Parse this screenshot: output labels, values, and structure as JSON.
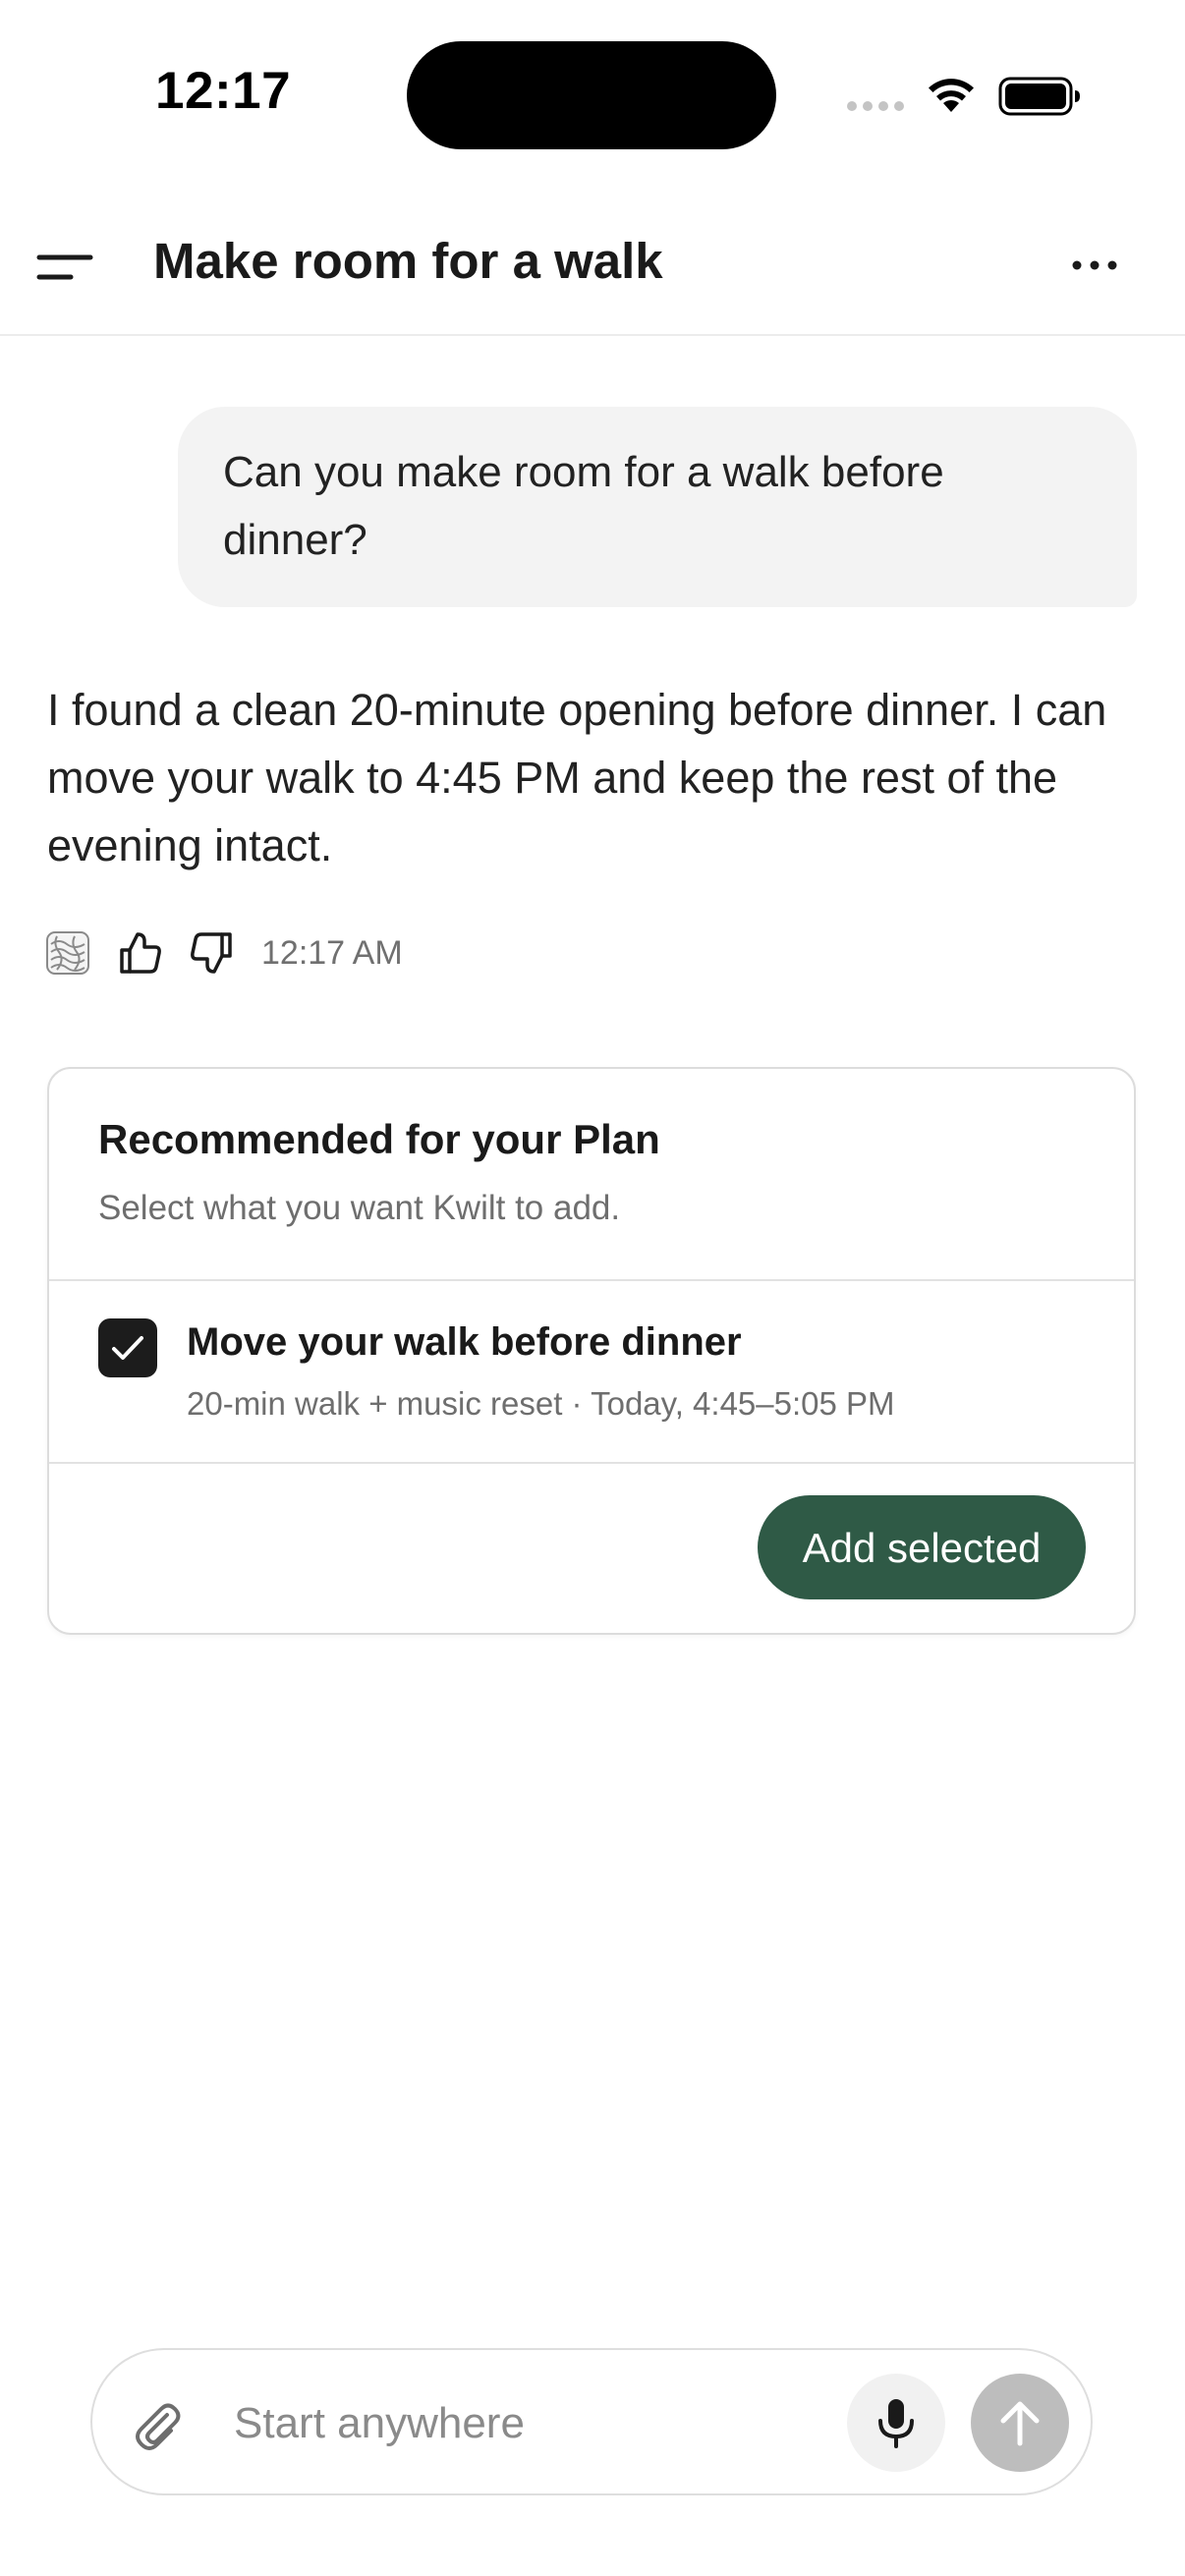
{
  "status_bar": {
    "time": "12:17"
  },
  "header": {
    "title": "Make room for a walk",
    "menu_icon": "hamburger-menu-icon",
    "more_icon": "more-horizontal-icon"
  },
  "conversation": {
    "user_message": "Can you make room for a walk before dinner?",
    "assistant_message": "I found a clean 20-minute opening before dinner. I can move your walk to 4:45 PM and keep the rest of the evening intact.",
    "assistant_timestamp": "12:17 AM"
  },
  "recommendation_card": {
    "title": "Recommended for your Plan",
    "subtitle": "Select what you want Kwilt to add.",
    "items": [
      {
        "checked": true,
        "title": "Move your walk before dinner",
        "detail": "20-min walk + music reset · Today, 4:45–5:05 PM"
      }
    ],
    "add_button_label": "Add selected"
  },
  "composer": {
    "placeholder": "Start anywhere",
    "value": ""
  },
  "colors": {
    "accent_green": "#2f5a46",
    "bubble_background": "#f3f3f3",
    "send_button_disabled": "#bdbdbd"
  }
}
